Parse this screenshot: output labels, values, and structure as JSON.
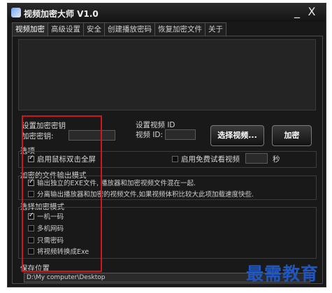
{
  "window": {
    "title": "视频加密大师 V1.0",
    "minimize": "_",
    "close": "X"
  },
  "tabs": [
    "视频加密",
    "高级设置",
    "安全",
    "创建播放密码",
    "恢复加密文件",
    "关于"
  ],
  "encryption_key": {
    "group_title": "设置加密密钥",
    "label": "加密密钥:",
    "value": ""
  },
  "video_id": {
    "group_title": "设置视频 ID",
    "label": "视频 ID:",
    "value": ""
  },
  "buttons": {
    "select_video": "选择视频...",
    "encrypt": "加密"
  },
  "options": {
    "title": "选项",
    "fullscreen_label": "启用鼠标双击全屏",
    "fullscreen_checked": true,
    "free_trial_label": "启用免费试看视频",
    "free_trial_checked": false,
    "seconds_value": "",
    "seconds_unit": "秒"
  },
  "output_mode": {
    "title": "加密的文件输出模式",
    "items": [
      {
        "label": "输出独立的EXE文件, 播放器和加密视频文件混在一起.",
        "checked": true
      },
      {
        "label": "分离输出播放器和加密的视频文件,如果视频体积比较大此项加载速度快些.",
        "checked": false
      }
    ]
  },
  "encrypt_mode": {
    "title": "选择加密模式",
    "items": [
      {
        "label": "一机一码",
        "checked": true
      },
      {
        "label": "多机网码",
        "checked": false
      },
      {
        "label": "只需密码",
        "checked": false
      },
      {
        "label": "将视频转换成Exe",
        "checked": false
      }
    ]
  },
  "save_location": {
    "title": "保存位置",
    "path": "D:\\My computer\\Desktop"
  },
  "watermark": "最需教育",
  "colors": {
    "background": "#181818",
    "highlight_box": "#d0161a",
    "watermark": "#1f56c0"
  }
}
